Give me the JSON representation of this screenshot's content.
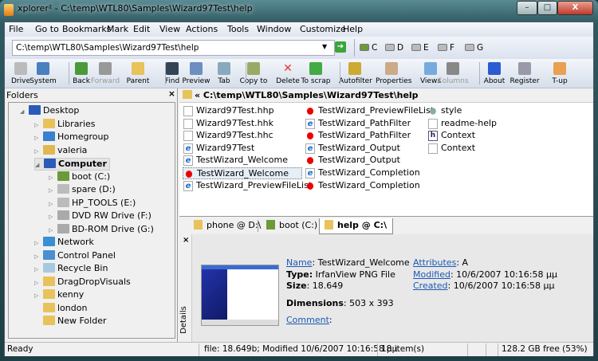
{
  "window": {
    "title": "xplorer² - C:\\temp\\WTL80\\Samples\\Wizard97Test\\help",
    "minimize": "–",
    "maximize": "□",
    "close": "X"
  },
  "menu": [
    "File",
    "Go to",
    "Bookmarks",
    "Mark",
    "Edit",
    "View",
    "Actions",
    "Tools",
    "Window",
    "Customize",
    "Help"
  ],
  "address": {
    "value": "C:\\temp\\WTL80\\Samples\\Wizard97Test\\help",
    "go_icon": "go-arrow-icon"
  },
  "drives": [
    "C",
    "D",
    "E",
    "F",
    "G"
  ],
  "toolbar": [
    "Drive",
    "System",
    "Back",
    "Forward",
    "Parent",
    "Find",
    "Preview",
    "Tab",
    "Copy to",
    "Delete",
    "To scrap",
    "Autofilter",
    "Properties",
    "Views",
    "Columns",
    "About",
    "Register",
    "T-up"
  ],
  "folders": {
    "title": "Folders",
    "close": "×",
    "tree": [
      {
        "label": "Desktop",
        "level": 0,
        "exp": "◢",
        "color": "#2a5bb8"
      },
      {
        "label": "Libraries",
        "level": 1,
        "exp": "▷",
        "color": "#e8c25a"
      },
      {
        "label": "Homegroup",
        "level": 1,
        "exp": "▷",
        "color": "#3a7fd0"
      },
      {
        "label": "valeria",
        "level": 1,
        "exp": "▷",
        "color": "#e0b850"
      },
      {
        "label": "Computer",
        "level": 1,
        "exp": "◢",
        "color": "#2a5bb8",
        "bold": true
      },
      {
        "label": "boot (C:)",
        "level": 2,
        "exp": "▷",
        "color": "#6c9a3a"
      },
      {
        "label": "spare (D:)",
        "level": 2,
        "exp": "▷",
        "color": "#bbbbbb"
      },
      {
        "label": "HP_TOOLS (E:)",
        "level": 2,
        "exp": "▷",
        "color": "#bbbbbb"
      },
      {
        "label": "DVD RW Drive (F:)",
        "level": 2,
        "exp": "▷",
        "color": "#aaaaaa"
      },
      {
        "label": "BD-ROM Drive (G:)",
        "level": 2,
        "exp": "▷",
        "color": "#aaaaaa"
      },
      {
        "label": "Network",
        "level": 1,
        "exp": "▷",
        "color": "#3a8fd0"
      },
      {
        "label": "Control Panel",
        "level": 1,
        "exp": "▷",
        "color": "#4a8fd0"
      },
      {
        "label": "Recycle Bin",
        "level": 1,
        "exp": "▷",
        "color": "#a8c8e0"
      },
      {
        "label": "DragDropVisuals",
        "level": 1,
        "exp": "▷",
        "color": "#e8c25a"
      },
      {
        "label": "kenny",
        "level": 1,
        "exp": "▷",
        "color": "#e8c25a"
      },
      {
        "label": "london",
        "level": 1,
        "exp": "",
        "color": "#e8c25a"
      },
      {
        "label": "New Folder",
        "level": 1,
        "exp": "",
        "color": "#e8c25a"
      }
    ]
  },
  "path": "« C:\\temp\\WTL80\\Samples\\Wizard97Test\\help",
  "files": [
    [
      {
        "name": "Wizard97Test.hhp",
        "icon": "doc"
      },
      {
        "name": "Wizard97Test.hhk",
        "icon": "doc"
      },
      {
        "name": "Wizard97Test.hhc",
        "icon": "doc"
      },
      {
        "name": "Wizard97Test",
        "icon": "ie"
      },
      {
        "name": "TestWizard_Welcome",
        "icon": "ie"
      },
      {
        "name": "TestWizard_Welcome",
        "icon": "png",
        "selected": true
      },
      {
        "name": "TestWizard_PreviewFileList",
        "icon": "ie"
      }
    ],
    [
      {
        "name": "TestWizard_PreviewFileList",
        "icon": "png"
      },
      {
        "name": "TestWizard_PathFilter",
        "icon": "ie"
      },
      {
        "name": "TestWizard_PathFilter",
        "icon": "png"
      },
      {
        "name": "TestWizard_Output",
        "icon": "ie"
      },
      {
        "name": "TestWizard_Output",
        "icon": "png"
      },
      {
        "name": "TestWizard_Completion",
        "icon": "ie"
      },
      {
        "name": "TestWizard_Completion",
        "icon": "png"
      }
    ],
    [
      {
        "name": "style",
        "icon": "gear"
      },
      {
        "name": "readme-help",
        "icon": "doc"
      },
      {
        "name": "Context",
        "icon": "h"
      },
      {
        "name": "Context",
        "icon": "doc"
      }
    ]
  ],
  "tabs": [
    {
      "label": "phone @ D:\\",
      "active": false
    },
    {
      "label": "boot (C:)",
      "active": false
    },
    {
      "label": "help @ C:\\",
      "active": true
    }
  ],
  "details": {
    "side_label": "Details",
    "close": "×",
    "name_label": "Name",
    "name": "TestWizard_Welcome",
    "type_label": "Type:",
    "type": "IrfanView PNG File",
    "size_label": "Size",
    "size": "18.649",
    "dimensions_label": "Dimensions",
    "dimensions": "503 x 393",
    "comment_label": "Comment",
    "attributes_label": "Attributes",
    "attributes": "A",
    "modified_label": "Modified",
    "modified": "10/6/2007 10:16:58 μμ",
    "created_label": "Created",
    "created": "10/6/2007 10:16:58 μμ"
  },
  "status": {
    "ready": "Ready",
    "file": "file: 18.649b; Modified 10/6/2007 10:16:58 μμ",
    "items": "18 item(s)",
    "free": "128.2 GB free (53%)"
  }
}
